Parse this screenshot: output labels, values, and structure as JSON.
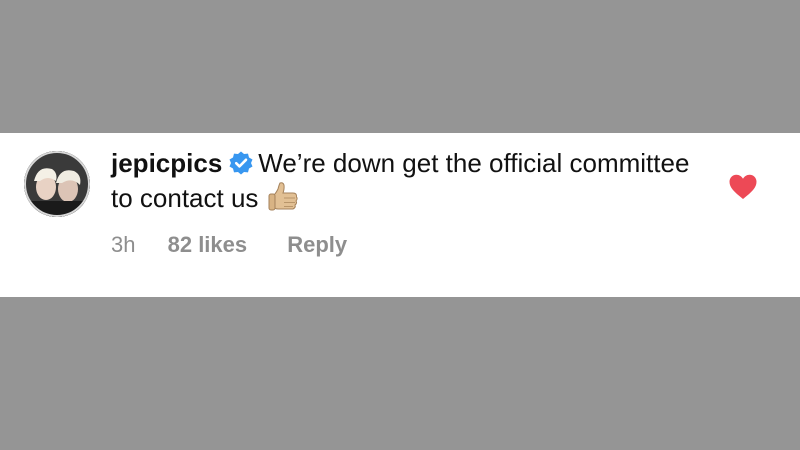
{
  "comment": {
    "username": "jepicpics",
    "verified": true,
    "text": "We’re down get the official committee to contact us",
    "emoji": "thumbs-up",
    "time": "3h",
    "likes": "82 likes",
    "reply_label": "Reply",
    "liked": true
  },
  "colors": {
    "background": "#959595",
    "card": "#ffffff",
    "verified_badge": "#3897f0",
    "heart": "#ed4956",
    "meta_text": "#8e8e8e"
  },
  "icons": {
    "avatar": "avatar",
    "verified": "verified-badge-icon",
    "emoji": "thumbs-up-icon",
    "like": "heart-icon"
  }
}
